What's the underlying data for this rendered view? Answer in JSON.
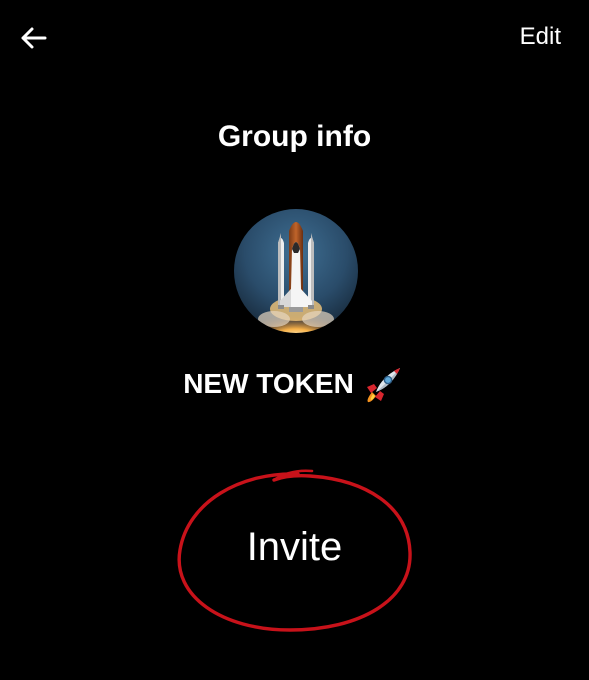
{
  "header": {
    "back_icon": "arrow-left-icon",
    "edit_label": "Edit"
  },
  "page": {
    "title": "Group info"
  },
  "group": {
    "avatar_icon": "space-shuttle-launch-image",
    "name": "NEW TOKEN",
    "name_emoji_icon": "rocket-emoji-icon"
  },
  "actions": {
    "invite_label": "Invite"
  },
  "annotation": {
    "type": "hand-drawn-circle",
    "color": "#c8121a"
  },
  "colors": {
    "background": "#000000",
    "text": "#ffffff"
  }
}
